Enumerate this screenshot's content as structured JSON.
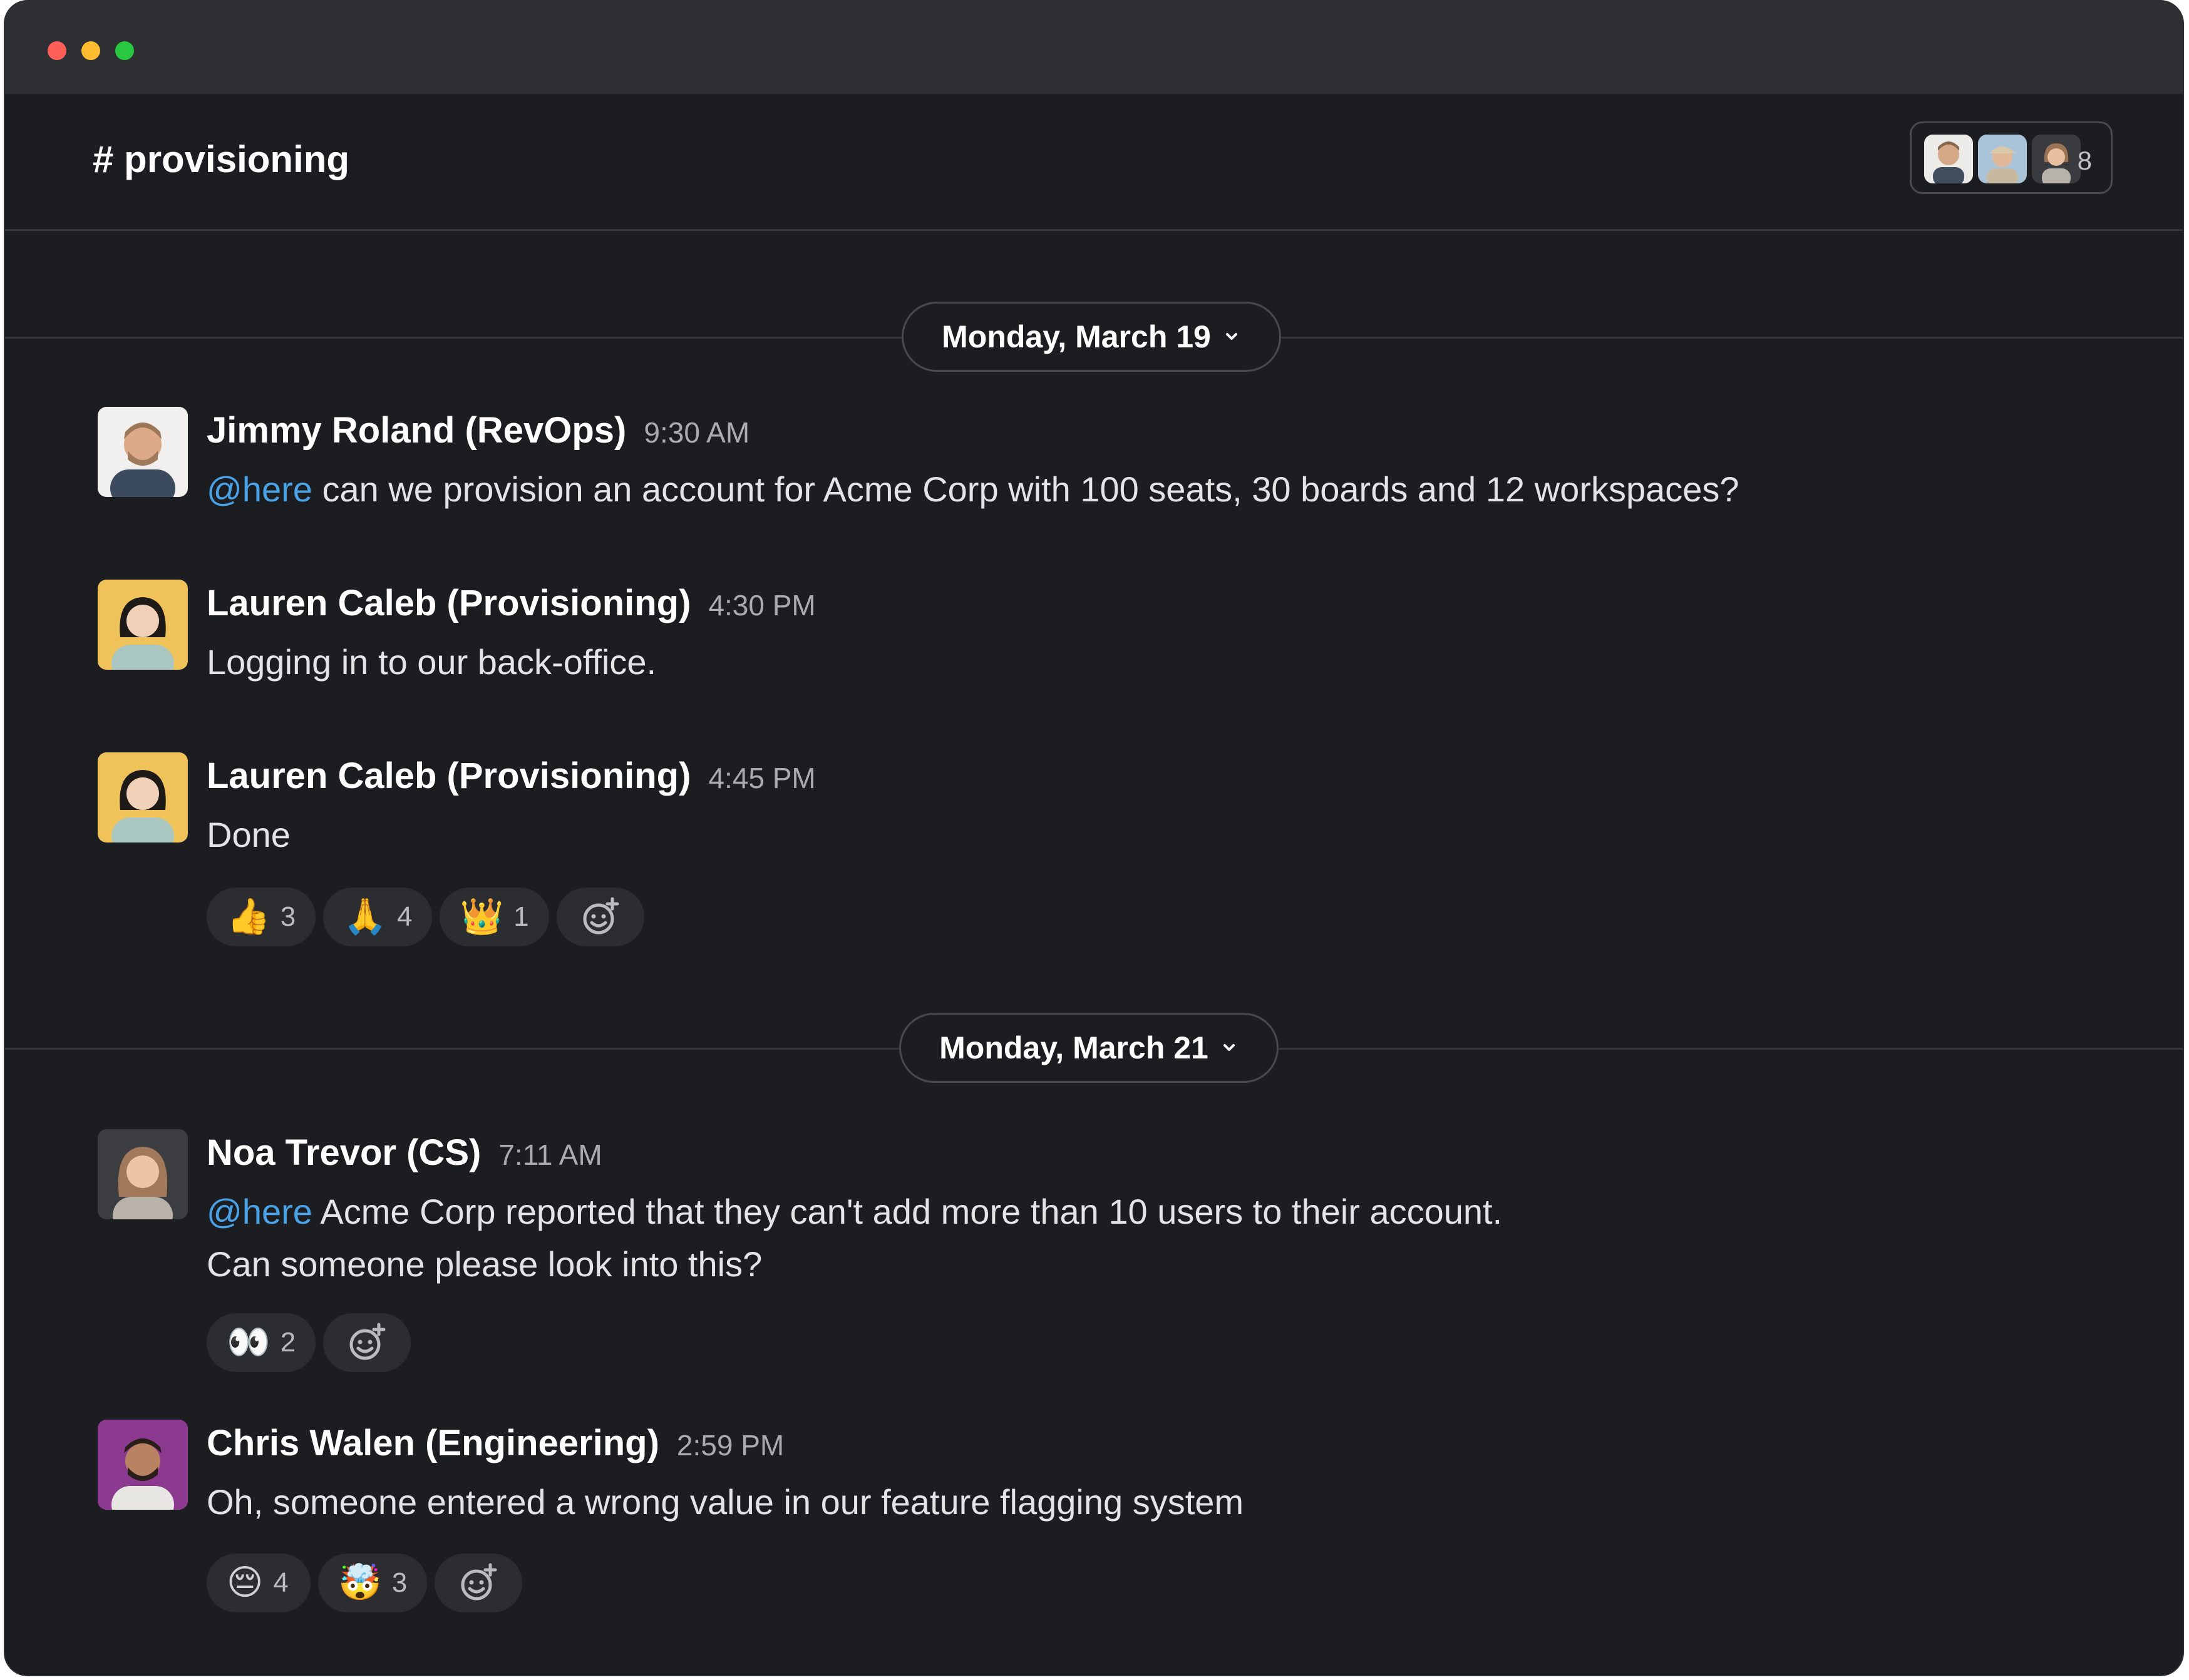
{
  "channel": {
    "title": "# provisioning",
    "member_count": "8"
  },
  "date_dividers": [
    {
      "label": "Monday, March 19"
    },
    {
      "label": "Monday, March 21"
    }
  ],
  "messages": [
    {
      "sender": "Jimmy Roland (RevOps)",
      "time": "9:30 AM",
      "mention": "@here",
      "text": " can we provision an account for Acme Corp with 100 seats, 30 boards and 12 workspaces?"
    },
    {
      "sender": "Lauren Caleb (Provisioning)",
      "time": "4:30 PM",
      "text": "Logging in to our back-office."
    },
    {
      "sender": "Lauren Caleb (Provisioning)",
      "time": "4:45 PM",
      "text": "Done",
      "reactions": [
        {
          "emoji": "👍",
          "count": "3"
        },
        {
          "emoji": "🙏",
          "count": "4"
        },
        {
          "emoji": "👑",
          "count": "1"
        }
      ]
    },
    {
      "sender": "Noa Trevor (CS)",
      "time": "7:11 AM",
      "mention": "@here",
      "text": " Acme Corp reported that they can't add more than 10 users to their account.",
      "text2": "Can someone please look into this?",
      "reactions": [
        {
          "emoji": "👀",
          "count": "2"
        }
      ]
    },
    {
      "sender": "Chris Walen (Engineering)",
      "time": "2:59 PM",
      "text": "Oh, someone entered a wrong value in our feature flagging system",
      "reactions": [
        {
          "emoji": "😔",
          "count": "4"
        },
        {
          "emoji": "🤯",
          "count": "3"
        }
      ]
    }
  ],
  "colors": {
    "background": "#1b1d21",
    "mention": "#4aa3e6",
    "reaction_bg": "#2b2d31"
  }
}
